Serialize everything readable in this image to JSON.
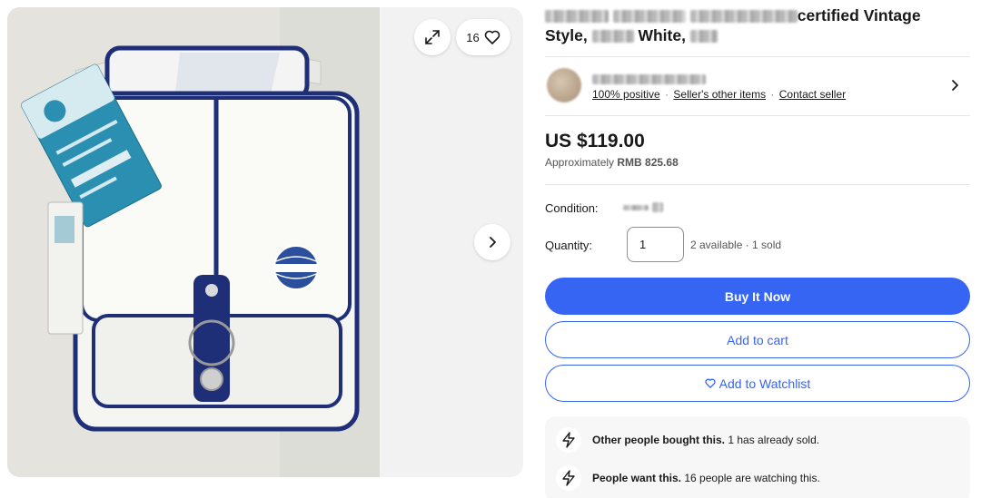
{
  "gallery": {
    "watch_count": "16",
    "icons": {
      "expand": "expand-icon",
      "heart": "heart-icon",
      "next": "chevron-right-icon"
    }
  },
  "listing": {
    "title_visible_1": "certified Vintage",
    "title_visible_2": "Style,",
    "title_visible_3": "White,"
  },
  "seller": {
    "feedback": "100% positive",
    "other_items": "Seller's other items",
    "contact": "Contact seller",
    "separator": "·"
  },
  "price": {
    "amount": "US $119.00",
    "approx_prefix": "Approximately",
    "approx_value": "RMB 825.68"
  },
  "condition": {
    "label": "Condition:"
  },
  "quantity": {
    "label": "Quantity:",
    "value": "1",
    "availability": "2 available · 1 sold"
  },
  "actions": {
    "buy_now": "Buy It Now",
    "add_to_cart": "Add to cart",
    "add_to_watchlist": "Add to Watchlist"
  },
  "signals": [
    {
      "icon": "lightning-icon",
      "headline": "Other people bought this.",
      "detail": "1 has already sold."
    },
    {
      "icon": "lightning-icon",
      "headline": "People want this.",
      "detail": "16 people are watching this."
    }
  ],
  "colors": {
    "accent": "#3665f3",
    "bag_trim": "#1e2f78",
    "tag_teal": "#2a8fb0"
  }
}
